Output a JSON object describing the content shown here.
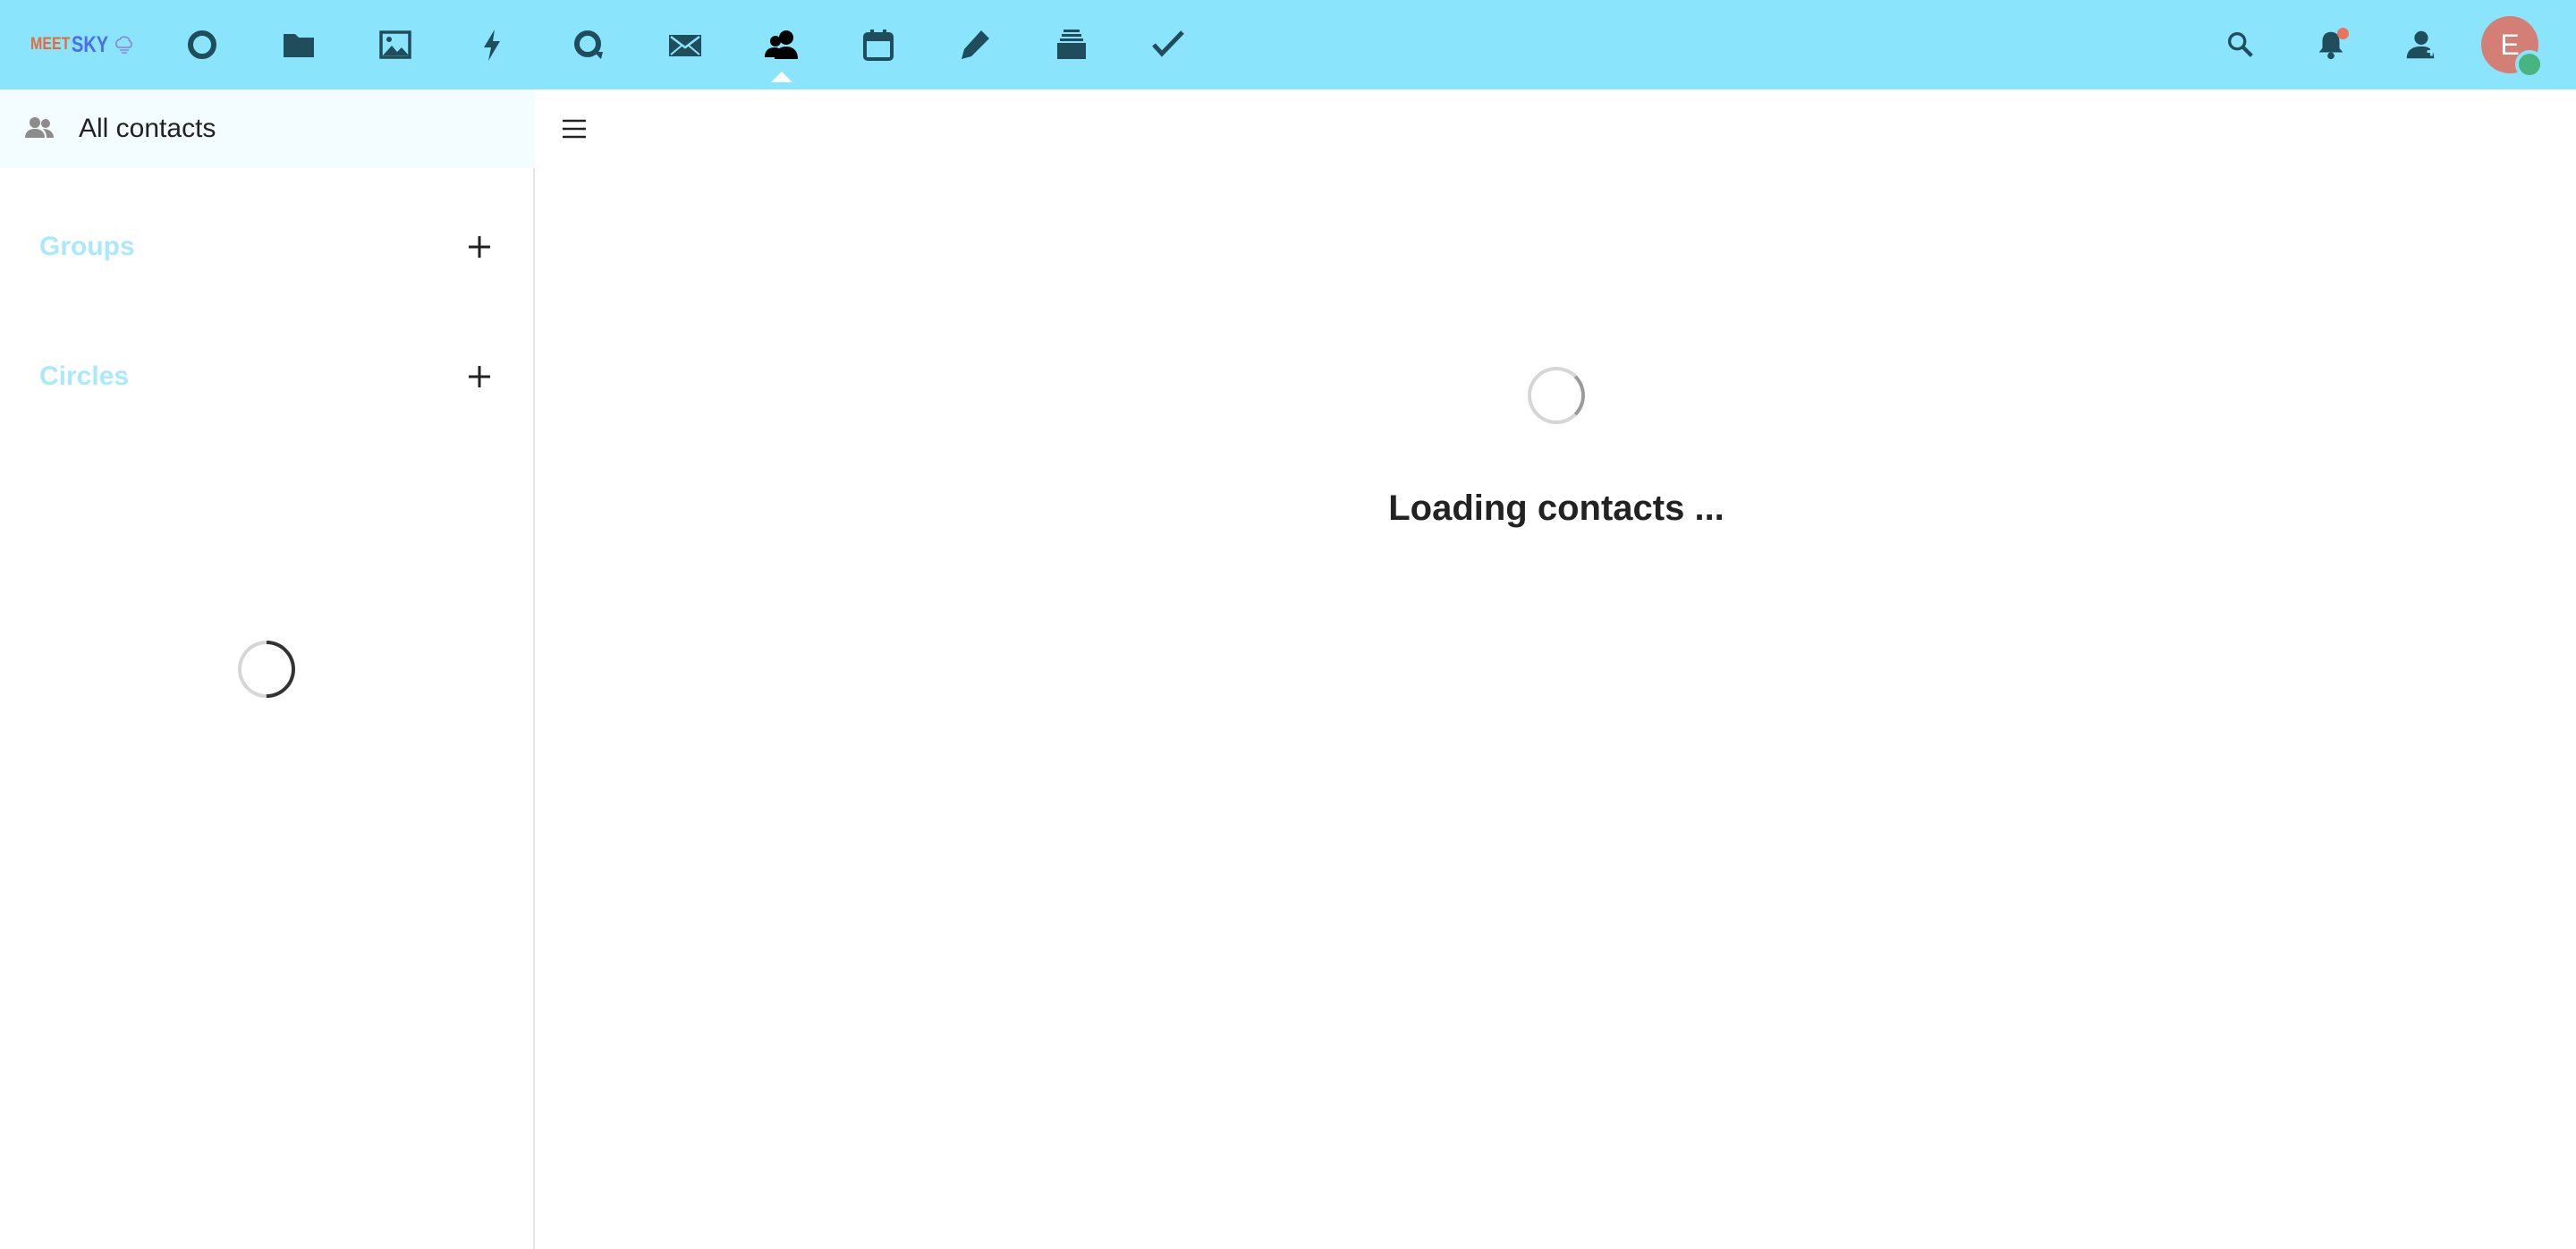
{
  "header": {
    "logo": {
      "meet": "MEET",
      "sky": "SKY"
    },
    "apps": [
      {
        "name": "dashboard-icon",
        "active": false
      },
      {
        "name": "files-icon",
        "active": false
      },
      {
        "name": "photos-icon",
        "active": false
      },
      {
        "name": "activity-icon",
        "active": false
      },
      {
        "name": "talk-icon",
        "active": false
      },
      {
        "name": "mail-icon",
        "active": false
      },
      {
        "name": "contacts-icon",
        "active": true
      },
      {
        "name": "calendar-icon",
        "active": false
      },
      {
        "name": "notes-icon",
        "active": false
      },
      {
        "name": "deck-icon",
        "active": false
      },
      {
        "name": "tasks-icon",
        "active": false
      }
    ],
    "avatar_initial": "E",
    "colors": {
      "header_bg": "#8ae5fc",
      "icon": "#1f4d5c",
      "avatar": "#d47f76",
      "status_online": "#49b382",
      "notification": "#e9745a"
    }
  },
  "sidebar": {
    "all_contacts_label": "All contacts",
    "groups_caption": "Groups",
    "circles_caption": "Circles"
  },
  "main": {
    "loading_text": "Loading contacts ..."
  }
}
